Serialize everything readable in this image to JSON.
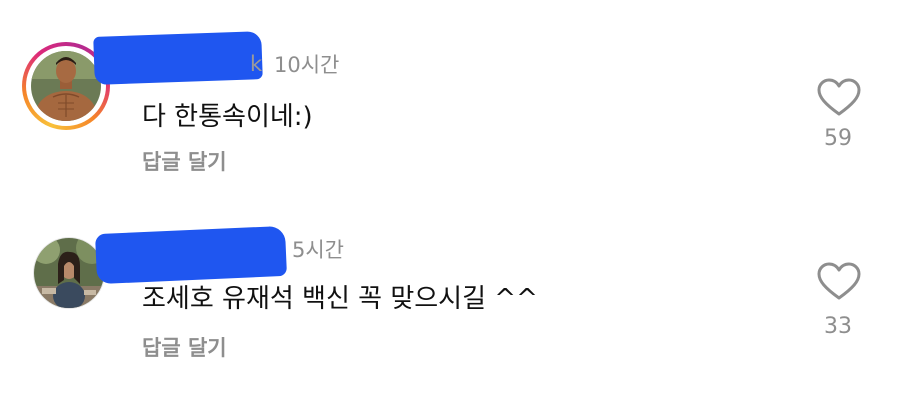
{
  "comments": [
    {
      "username_tail": "k",
      "timestamp": "10시간",
      "text": "다 한통속이네:)",
      "reply_label": "답글 달기",
      "like_count": "59",
      "has_story_ring": true
    },
    {
      "timestamp": "5시간",
      "text": "조세호 유재석 백신 꼭 맞으시길 ^^",
      "reply_label": "답글 달기",
      "like_count": "33",
      "has_story_ring": false
    }
  ],
  "colors": {
    "redaction": "#1f56f0",
    "muted_text": "#8e8e8e",
    "primary_text": "#111111",
    "story_ring": [
      "#f8c13a",
      "#f58529",
      "#dd2a7b",
      "#b42a8f"
    ]
  },
  "icons": {
    "like": "heart-outline-icon"
  }
}
